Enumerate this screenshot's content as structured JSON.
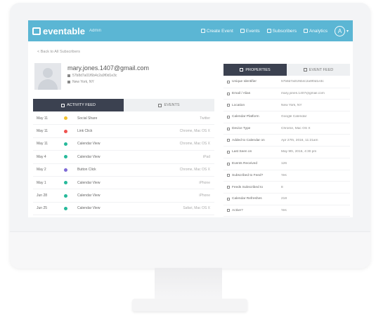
{
  "app": {
    "brand": "eventable",
    "brand_sub": "Admin"
  },
  "nav": [
    {
      "label": "Create Event",
      "icon": "plus-icon"
    },
    {
      "label": "Events",
      "icon": "calendar-icon"
    },
    {
      "label": "Subscribers",
      "icon": "users-icon"
    },
    {
      "label": "Analytics",
      "icon": "chart-icon"
    }
  ],
  "account": {
    "initial": "A"
  },
  "back_link": "< Back to All Subscribers",
  "profile": {
    "email": "mary.jones.1407@gmail.com",
    "id_line": "57b8d7a01f6b4c2a9f0d1e3c",
    "location": "New York, NY"
  },
  "left_tabs": [
    {
      "label": "ACTIVITY FEED",
      "icon": "list-icon"
    },
    {
      "label": "EVENTS",
      "icon": "calendar-icon"
    }
  ],
  "feed": [
    {
      "date": "May 11",
      "event": "Social Share",
      "time": "Twitter",
      "color": "#f2c12e"
    },
    {
      "date": "May 11",
      "event": "Link Click",
      "time": "Chrome, Mac OS X",
      "color": "#ef5350"
    },
    {
      "date": "May 11",
      "event": "Calendar View",
      "time": "Chrome, Mac OS X",
      "color": "#26b99a"
    },
    {
      "date": "May 4",
      "event": "Calendar View",
      "time": "iPad",
      "color": "#26b99a"
    },
    {
      "date": "May 2",
      "event": "Button Click",
      "time": "Chrome, Mac OS X",
      "color": "#7e6bd6"
    },
    {
      "date": "May 1",
      "event": "Calendar View",
      "time": "iPhone",
      "color": "#26b99a"
    },
    {
      "date": "Jun 28",
      "event": "Calendar View",
      "time": "iPhone",
      "color": "#26b99a"
    },
    {
      "date": "Jun 25",
      "event": "Calendar View",
      "time": "Safari, Mac OS X",
      "color": "#26b99a"
    }
  ],
  "right_tabs": [
    {
      "label": "PROPERTIES",
      "icon": "lock-icon"
    },
    {
      "label": "EVENT FEED",
      "icon": "list-icon"
    }
  ],
  "properties": [
    {
      "key": "Unique Identifier",
      "value": "57b8d7a01f6b4c2a9f0d1e3c"
    },
    {
      "key": "Email / Alias",
      "value": "mary.jones.1407@gmail.com"
    },
    {
      "key": "Location",
      "value": "New York, NY"
    },
    {
      "key": "Calendar Platform",
      "value": "Google Calendar"
    },
    {
      "key": "Device Type",
      "value": "Chrome, Mac OS X"
    },
    {
      "key": "Added to Calendar on",
      "value": "Apr 27th, 2016, 11:21am"
    },
    {
      "key": "Last Seen on",
      "value": "May 9th, 2016, 4:30 pm"
    },
    {
      "key": "Events Received",
      "value": "126"
    },
    {
      "key": "Subscribed to Feed?",
      "value": "Yes"
    },
    {
      "key": "Feeds Subscribed to",
      "value": "8"
    },
    {
      "key": "Calendar Refreshes",
      "value": "218"
    },
    {
      "key": "Active?",
      "value": "Yes"
    }
  ],
  "colors": {
    "brand_bar": "#5bb6d4",
    "dark_tab": "#3b4150"
  }
}
